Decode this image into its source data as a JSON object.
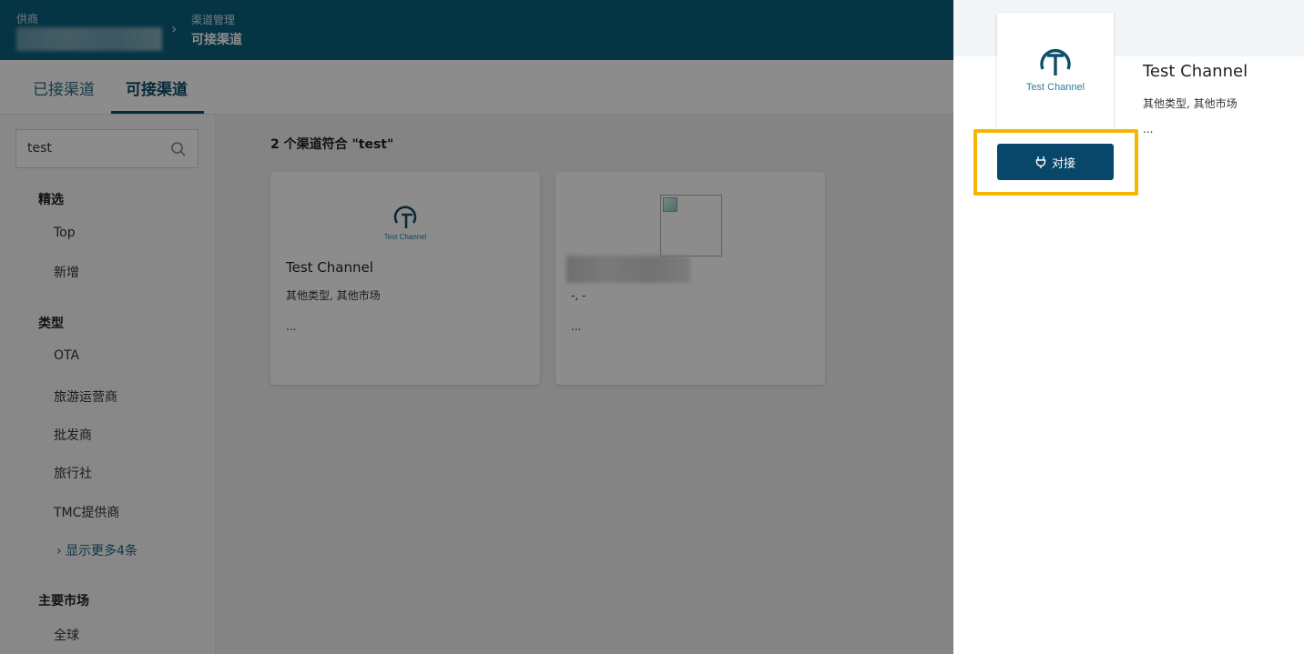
{
  "header": {
    "account_label": "供商",
    "breadcrumb_parent": "渠道管理",
    "breadcrumb_current": "可接渠道"
  },
  "tabs": [
    {
      "label": "已接渠道",
      "active": false
    },
    {
      "label": "可接渠道",
      "active": true
    }
  ],
  "sidebar": {
    "search_value": "test",
    "groups": [
      {
        "title": "精选",
        "items": [
          "Top",
          "新增"
        ]
      },
      {
        "title": "类型",
        "items": [
          "OTA",
          "旅游运营商",
          "批发商",
          "旅行社",
          "TMC提供商"
        ],
        "more": "显示更多4条"
      },
      {
        "title": "主要市场",
        "items": [
          "全球"
        ]
      }
    ]
  },
  "results": {
    "count_text": "2 个渠道符合 \"test\"",
    "cards": [
      {
        "name": "Test Channel",
        "meta": "其他类型, 其他市场",
        "more": "..."
      },
      {
        "name": "",
        "meta": "-, -",
        "more": "..."
      }
    ]
  },
  "drawer": {
    "logo_text": "Test Channel",
    "name": "Test Channel",
    "meta": "其他类型, 其他市场",
    "more": "...",
    "connect_label": "对接"
  },
  "colors": {
    "header_bg": "#0a5f7d",
    "primary": "#08476a",
    "highlight": "#f7b500"
  }
}
